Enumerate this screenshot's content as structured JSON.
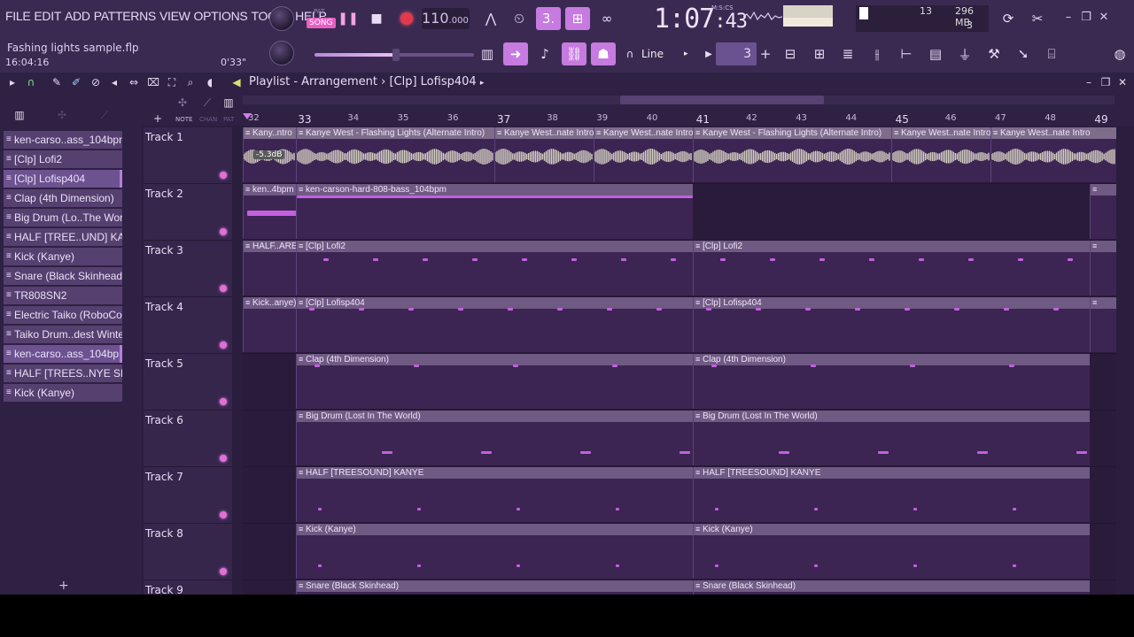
{
  "menu": [
    "FILE",
    "EDIT",
    "ADD",
    "PATTERNS",
    "VIEW",
    "OPTIONS",
    "TOOLS",
    "HELP"
  ],
  "song": {
    "title": "Fashing lights sample.flp",
    "time": "16:04:16",
    "length": "0'33\""
  },
  "transport": {
    "pat_label": "PAT",
    "song_label": "SONG",
    "tempo": "110",
    "tempo_decimal": ".000",
    "time_main": "1:07",
    "time_sub": ":43",
    "time_format": "M:S:CS"
  },
  "stats": {
    "poly": "13",
    "memory": "296 MB",
    "cpu": "3"
  },
  "snap": {
    "value": "Line",
    "step": "3"
  },
  "playlist": {
    "title": "Playlist - Arrangement",
    "breadcrumb_sep": "›",
    "pattern": "[Clp] Lofisp404"
  },
  "ruler": [
    "32",
    "33",
    "34",
    "35",
    "36",
    "37",
    "38",
    "39",
    "40",
    "41",
    "42",
    "43",
    "44",
    "45",
    "46",
    "47",
    "48",
    "49"
  ],
  "picker_items": [
    "ken-carso..ass_104bpm",
    "[Clp] Lofi2",
    "[Clp] Lofisp404",
    "Clap (4th Dimension)",
    "Big Drum (Lo..The World)",
    "HALF [TREE..UND] KANYE",
    "Kick (Kanye)",
    "Snare (Black Skinhead)",
    "TR808SN2",
    "Electric Taiko (RoboCop)",
    "Taiko Drum..dest Winter)",
    "ken-carso..ass_104bpm",
    "HALF [TREES..NYE SNARE",
    "Kick (Kanye)"
  ],
  "tracks": [
    {
      "name": "Track 1",
      "clips": [
        {
          "label": "Kany..ntro",
          "audio": true
        },
        {
          "label": "Kanye West - Flashing Lights (Alternate Intro)",
          "audio": true
        },
        {
          "label": "Kanye West..nate Intro",
          "audio": true
        },
        {
          "label": "Kanye West..nate Intro",
          "audio": true
        },
        {
          "label": "Kanye West - Flashing Lights (Alternate Intro)",
          "audio": true
        },
        {
          "label": "Kanye West..nate Intro",
          "audio": true
        },
        {
          "label": "Kanye West..nate Intro",
          "audio": true
        }
      ],
      "vol": "-5.3dB"
    },
    {
      "name": "Track 2",
      "clips": [
        {
          "label": "ken..4bpm"
        },
        {
          "label": "ken-carson-hard-808-bass_104bpm"
        },
        {
          "label": ""
        }
      ]
    },
    {
      "name": "Track 3",
      "clips": [
        {
          "label": "HALF..ARE"
        },
        {
          "label": "[Clp] Lofi2"
        },
        {
          "label": "[Clp] Lofi2"
        },
        {
          "label": ""
        }
      ]
    },
    {
      "name": "Track 4",
      "clips": [
        {
          "label": "Kick..anye)"
        },
        {
          "label": "[Clp] Lofisp404"
        },
        {
          "label": "[Clp] Lofisp404"
        },
        {
          "label": ""
        }
      ]
    },
    {
      "name": "Track 5",
      "clips": [
        {
          "label": "Clap (4th Dimension)"
        },
        {
          "label": "Clap (4th Dimension)"
        }
      ]
    },
    {
      "name": "Track 6",
      "clips": [
        {
          "label": "Big Drum (Lost In The World)"
        },
        {
          "label": "Big Drum (Lost In The World)"
        }
      ]
    },
    {
      "name": "Track 7",
      "clips": [
        {
          "label": "HALF [TREESOUND] KANYE"
        },
        {
          "label": "HALF [TREESOUND] KANYE"
        }
      ]
    },
    {
      "name": "Track 8",
      "clips": [
        {
          "label": "Kick (Kanye)"
        },
        {
          "label": "Kick (Kanye)"
        }
      ]
    },
    {
      "name": "Track 9",
      "clips": [
        {
          "label": "Snare (Black Skinhead)"
        },
        {
          "label": "Snare (Black Skinhead)"
        }
      ]
    }
  ],
  "colors": {
    "accent": "#c77ae0",
    "note": "#c260e0",
    "clip_header": "#6f5a84",
    "background": "#2b1d3d"
  }
}
